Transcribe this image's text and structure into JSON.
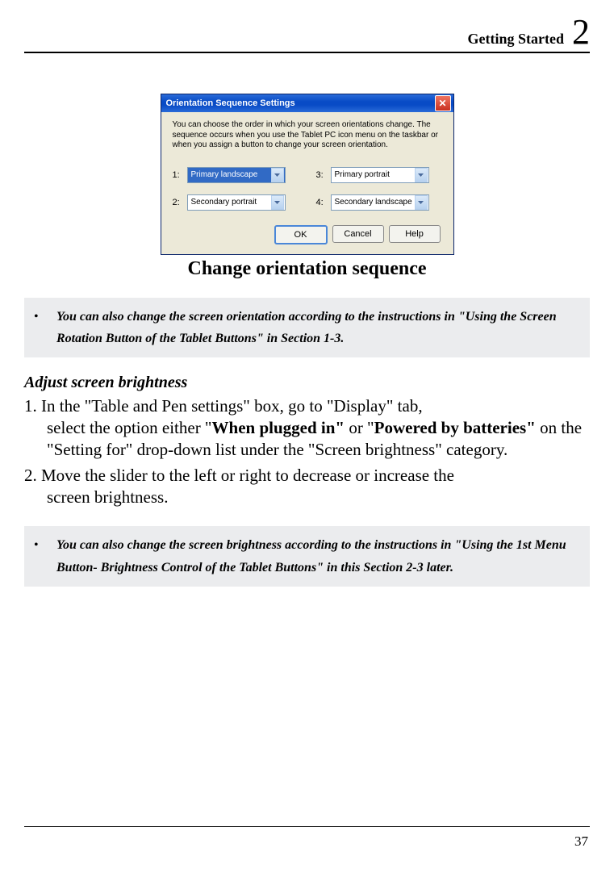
{
  "header": {
    "title": "Getting Started",
    "chapter": "2"
  },
  "dialog": {
    "title": "Orientation Sequence Settings",
    "close": "✕",
    "description": "You can choose the order in which your screen orientations change. The sequence occurs when you use the Tablet PC icon menu on the taskbar or when you assign a button to change your screen orientation.",
    "labels": {
      "n1": "1:",
      "n2": "2:",
      "n3": "3:",
      "n4": "4:"
    },
    "combos": {
      "c1": "Primary landscape",
      "c2": "Secondary portrait",
      "c3": "Primary portrait",
      "c4": "Secondary landscape"
    },
    "buttons": {
      "ok": "OK",
      "cancel": "Cancel",
      "help": "Help"
    }
  },
  "caption": "Change orientation sequence",
  "note1": "You can also change the screen orientation according to the instructions in \"Using the Screen Rotation Button of the Tablet Buttons\" in Section 1-3.",
  "subhead": "Adjust screen brightness",
  "step1": {
    "lead": "1. In the \"Table and Pen settings\" box, go to \"Display\" tab,",
    "cont1a": "select the option either \"",
    "bold1": "When plugged in\"",
    "mid": " or \"",
    "bold2": "Powered by batteries\"",
    "cont1b": " on the \"Setting for\" drop-down list under the \"Screen brightness\" category."
  },
  "step2": {
    "lead": "2. Move the slider to the left or right to decrease or increase the",
    "cont": "screen brightness."
  },
  "note2": "You can also change the screen brightness according to the instructions in \"Using the 1st Menu Button- Brightness Control of the Tablet Buttons\" in this Section 2-3 later.",
  "pageNumber": "37"
}
